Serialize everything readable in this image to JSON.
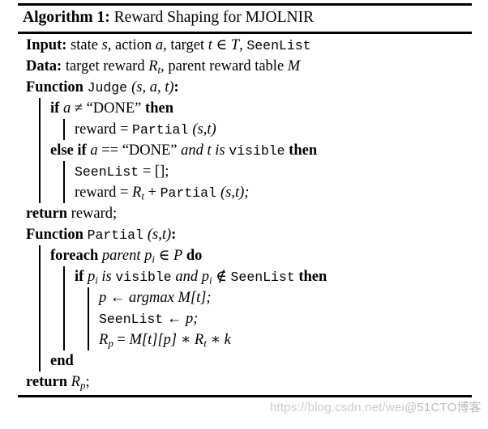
{
  "caption": {
    "label": "Algorithm 1:",
    "title": "Reward Shaping for MJOLNIR"
  },
  "lines": {
    "input_kw": "Input:",
    "input_rest_1": "state",
    "input_var_s": "s",
    "input_rest_2": ", action",
    "input_var_a": "a",
    "input_rest_3": ", target",
    "input_var_t": "t",
    "input_in": "∈",
    "input_var_T": "T",
    "input_comma": ",",
    "input_seenlist": "SeenList",
    "data_kw": "Data:",
    "data_rest_1": "target reward",
    "data_var_R": "R",
    "data_sub_t": "t",
    "data_rest_2": ", parent reward table",
    "data_var_M": "M",
    "fn_kw": "Function",
    "fn_judge_name": "Judge",
    "fn_judge_args_open": "(",
    "fn_judge_arg_s": "s",
    "fn_judge_sep1": ",",
    "fn_judge_arg_a": "a",
    "fn_judge_sep2": ",",
    "fn_judge_arg_t": "t",
    "fn_judge_args_close": ")",
    "fn_colon": ":",
    "if_kw": "if",
    "if_var_a": "a",
    "if_neq": "≠",
    "if_done": "“DONE”",
    "then_kw": "then",
    "reward_assign_lhs": "reward =",
    "partial_name": "Partial",
    "partial_args_st": "(s,t)",
    "elseif_kw": "else if",
    "elseif_var_a": "a",
    "elseif_eqeq": "==",
    "elseif_done": "“DONE”",
    "elseif_and": "and",
    "elseif_var_t": "t",
    "elseif_is": "is",
    "elseif_visible": "visible",
    "seenlist_empty_name": "SeenList",
    "seenlist_empty_rest": "= [];",
    "reward_rt_lhs": "reward =",
    "reward_rt_R": "R",
    "reward_rt_sub": "t",
    "reward_rt_plus": "+",
    "reward_rt_partial": "Partial",
    "reward_rt_args": "(s,t);",
    "return_kw": "return",
    "return_reward": "reward;",
    "fn_partial_kw": "Function",
    "fn_partial_name": "Partial",
    "fn_partial_args": "(s,t)",
    "fn_partial_colon": ":",
    "foreach_kw": "foreach",
    "foreach_parent": "parent",
    "foreach_var_p": "p",
    "foreach_sub_i": "i",
    "foreach_in": "∈",
    "foreach_var_P": "P",
    "foreach_do": "do",
    "if2_kw": "if",
    "if2_var_p": "p",
    "if2_sub_i": "i",
    "if2_is": "is",
    "if2_visible": "visible",
    "if2_and": "and",
    "if2_var_p2": "p",
    "if2_sub_i2": "i",
    "if2_notin": "∉",
    "if2_seenlist": "SeenList",
    "if2_then": "then",
    "argmax_var_p": "p",
    "argmax_arrow": "←",
    "argmax_kw": "argmax",
    "argmax_var_M": "M",
    "argmax_bracket": "[t];",
    "push_seenlist": "SeenList",
    "push_arrow": "←",
    "push_var_p": "p;",
    "rp_var_R": "R",
    "rp_sub_p": "p",
    "rp_eq": "=",
    "rp_var_M": "M",
    "rp_idx_t": "[t]",
    "rp_idx_p": "[p]",
    "rp_mul1": "∗",
    "rp_var_R2": "R",
    "rp_sub_t": "t",
    "rp_mul2": "∗",
    "rp_var_k": "k",
    "end_kw": "end",
    "return2_kw": "return",
    "return2_var_R": "R",
    "return2_sub_p": "p",
    "return2_semi": ";"
  },
  "watermark": {
    "url": "https://blog.csdn.net/wei",
    "tail": "@51CTO博客"
  }
}
